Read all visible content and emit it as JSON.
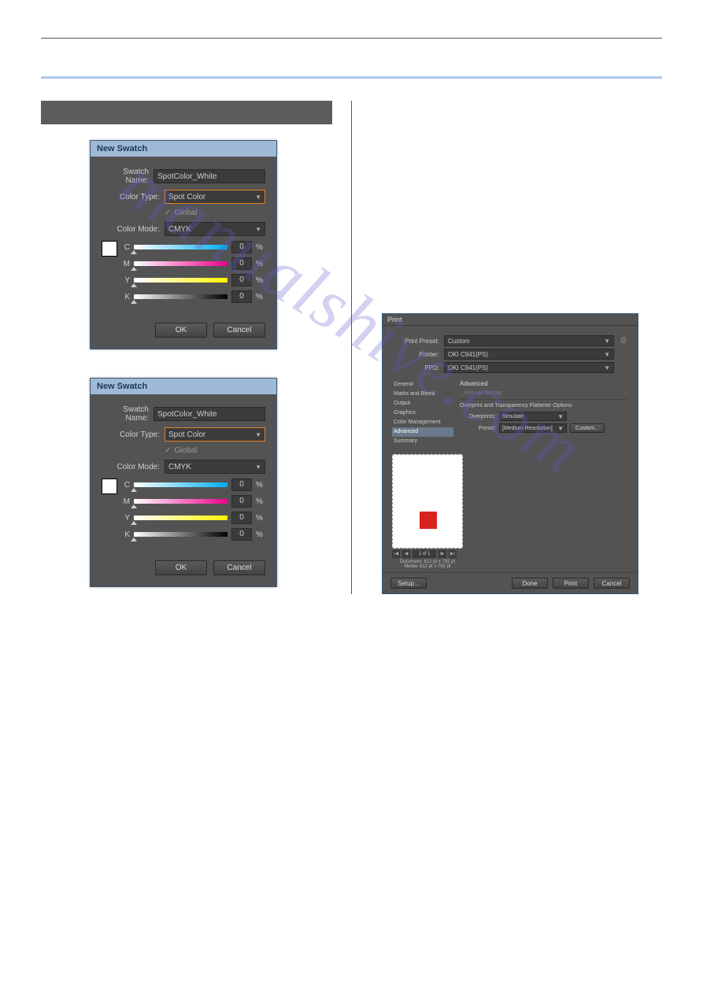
{
  "watermark": "manualshive.com",
  "dialogs": {
    "newSwatch": {
      "title": "New Swatch",
      "labels": {
        "swatchName": "Swatch Name:",
        "colorType": "Color Type:",
        "global": "Global",
        "colorMode": "Color Mode:",
        "pct": "%"
      },
      "values": {
        "swatchName": "SpotColor_White",
        "colorType": "Spot Color",
        "colorMode": "CMYK",
        "c": "0",
        "m": "0",
        "y": "0",
        "k": "0"
      },
      "buttons": {
        "ok": "OK",
        "cancel": "Cancel"
      },
      "channels": [
        "C",
        "M",
        "Y",
        "K"
      ]
    }
  },
  "printDialog": {
    "title": "Print",
    "top": {
      "printPresetLabel": "Print Preset:",
      "printPreset": "Custom",
      "printerLabel": "Printer:",
      "printer": "OKI C941(PS)",
      "ppdLabel": "PPD:",
      "ppd": "OKI C941(PS)"
    },
    "list": [
      "General",
      "Marks and Bleed",
      "Output",
      "Graphics",
      "Color Management",
      "Advanced",
      "Summary"
    ],
    "listSelected": "Advanced",
    "right": {
      "heading": "Advanced",
      "printAsBitmap": "Print as Bitmap",
      "flattenerTitle": "Overprint and Transparency Flattener Options",
      "overprintsLabel": "Overprints:",
      "overprints": "Simulate",
      "presetLabel": "Preset:",
      "preset": "[Medium Resolution]",
      "customBtn": "Custom..."
    },
    "nav": {
      "page": "1 of 1"
    },
    "dims": {
      "doc": "Document: 612 pt x 792 pt",
      "media": "Media: 612 pt x 792 pt"
    },
    "footer": {
      "setup": "Setup...",
      "done": "Done",
      "print": "Print",
      "cancel": "Cancel"
    }
  }
}
